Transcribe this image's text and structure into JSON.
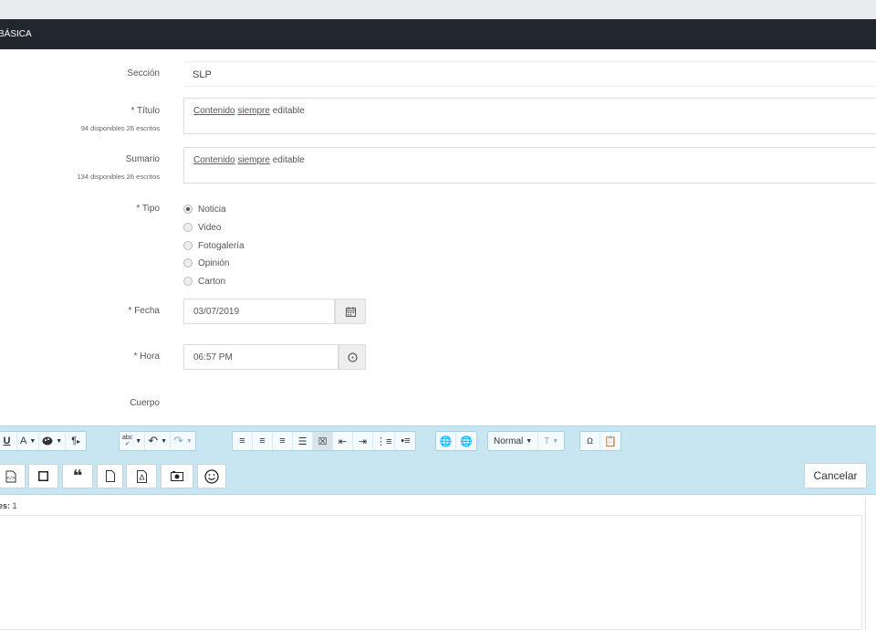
{
  "header": {
    "title": "BÁSICA"
  },
  "form": {
    "seccion": {
      "label": "Sección",
      "value": "SLP"
    },
    "titulo": {
      "label": "* Título",
      "counter": "94 disponibles 26 escritos",
      "word1": "Contenido",
      "word2": "siempre",
      "word3": "editable"
    },
    "sumario": {
      "label": "Sumario",
      "counter": "134 disponibles 26 escritos",
      "word1": "Contenido",
      "word2": "siempre",
      "word3": "editable"
    },
    "tipo": {
      "label": "* Tipo",
      "options": [
        "Noticia",
        "Video",
        "Fotogalería",
        "Opinión",
        "Carton"
      ],
      "selected": "Noticia"
    },
    "fecha": {
      "label": "* Fecha",
      "value": "03/07/2019"
    },
    "hora": {
      "label": "* Hora",
      "value": "06:57 PM"
    },
    "cuerpo": {
      "label": "Cuerpo"
    }
  },
  "editor": {
    "format_select": "Normal",
    "size_select": "T",
    "underline": "U",
    "font_color": "A",
    "paragraph": "¶",
    "cancel_label": "Cancelar",
    "status_label": "es:",
    "status_value": "1"
  },
  "icons": {
    "calendar": "calendar-icon",
    "clock": "clock-icon",
    "quote": "quote-icon",
    "smiley": "smiley-icon"
  }
}
